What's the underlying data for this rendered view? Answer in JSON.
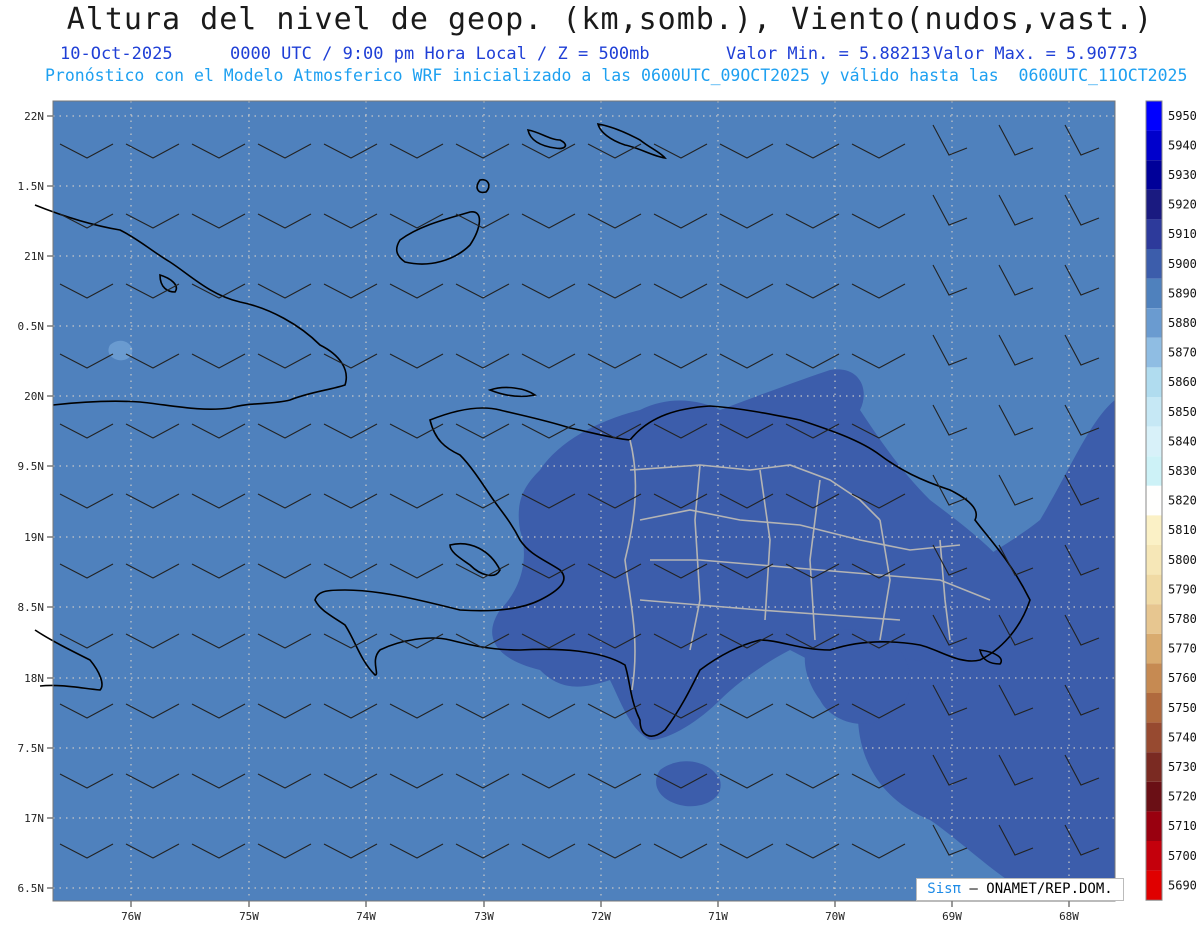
{
  "header": {
    "title": "Altura del nivel de geop. (km,somb.), Viento(nudos,vast.)",
    "date": "10-Oct-2025",
    "time_info": "0000 UTC / 9:00 pm Hora Local / Z = 500mb",
    "min_label": "Valor Min. = 5.88213",
    "max_label": "Valor Max. = 5.90773",
    "model_info": "Pronóstico con el Modelo Atmosferico WRF inicializado a las 0600UTC_09OCT2025 y válido hasta las  0600UTC_11OCT2025"
  },
  "map": {
    "lat_labels": [
      "22N",
      "1.5N",
      "21N",
      "0.5N",
      "20N",
      "9.5N",
      "19N",
      "8.5N",
      "18N",
      "7.5N",
      "17N",
      "6.5N"
    ],
    "lon_labels": [
      "76W",
      "75W",
      "74W",
      "73W",
      "72W",
      "71W",
      "70W",
      "69W",
      "68W"
    ],
    "background_color": "#4f81bd",
    "land_shade_color": "#3c5dab",
    "regions_shown": [
      "Cuba (east)",
      "Bahamas",
      "Haiti",
      "Dominican Republic",
      "Jamaica (east)"
    ]
  },
  "colorbar": {
    "levels": [
      "5950",
      "5940",
      "5930",
      "5920",
      "5910",
      "5900",
      "5890",
      "5880",
      "5870",
      "5860",
      "5850",
      "5840",
      "5830",
      "5820",
      "5810",
      "5800",
      "5790",
      "5780",
      "5770",
      "5760",
      "5750",
      "5740",
      "5730",
      "5720",
      "5710",
      "5700",
      "5690"
    ],
    "colors": [
      "#0000ff",
      "#0000cc",
      "#000099",
      "#1a1a80",
      "#2d3a9b",
      "#3c5dab",
      "#4f81bd",
      "#6a9bd0",
      "#8fbde3",
      "#b0dcef",
      "#c6e8f5",
      "#d8f1f9",
      "#cdf2f7",
      "#fffffe",
      "#fbf1c6",
      "#f6e7b7",
      "#f0daa4",
      "#e7c690",
      "#d9ab6f",
      "#c68a52",
      "#b06a3e",
      "#974a30",
      "#7a2a22",
      "#6a0f15",
      "#99000f",
      "#c4000c",
      "#e00000"
    ]
  },
  "credit": {
    "logo": "Sisπ",
    "text": "– ONAMET/REP.DOM."
  }
}
